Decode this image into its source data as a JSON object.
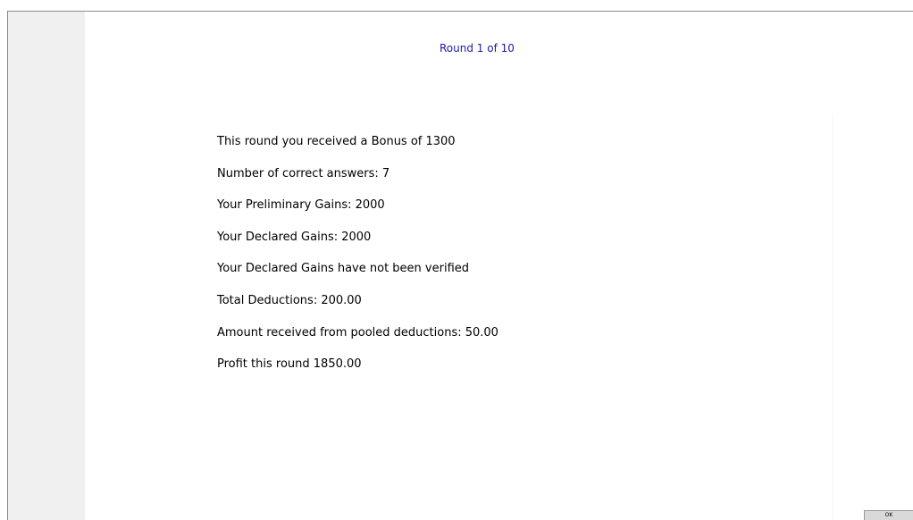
{
  "header": {
    "round_label": "Round 1 of 10"
  },
  "results": {
    "lines": [
      "This round you received a Bonus of 1300",
      "Number of correct answers: 7",
      "Your Preliminary Gains: 2000",
      "Your Declared Gains: 2000",
      "Your Declared Gains have not been verified",
      "Total Deductions: 200.00",
      "Amount received from pooled deductions: 50.00",
      "Profit this round 1850.00"
    ]
  },
  "footer": {
    "ok_label": "OK"
  },
  "colors": {
    "round_text": "#1a1aa6",
    "side_panel": "#f0f0f0",
    "button_face": "#d9d9d9"
  }
}
